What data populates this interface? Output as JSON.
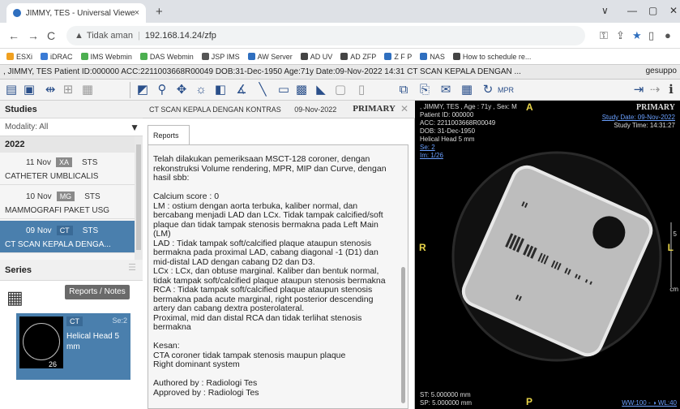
{
  "browser": {
    "tab_title": "JIMMY, TES - Universal Viewer :",
    "tab_close": "×",
    "new_tab": "+",
    "win_min": "∨",
    "win_dash": "—",
    "win_restore": "▢",
    "win_close": "✕",
    "back": "←",
    "forward": "→",
    "reload": "C",
    "security_warning": "▲",
    "security_label": "Tidak aman",
    "url": "192.168.14.24/zfp",
    "bookmarks": [
      {
        "label": "ESXi",
        "color": "#f0a020"
      },
      {
        "label": "iDRAC",
        "color": "#3a7bd5"
      },
      {
        "label": "IMS Webmin",
        "color": "#4caf50"
      },
      {
        "label": "DAS Webmin",
        "color": "#4caf50"
      },
      {
        "label": "JSP IMS",
        "color": "#555555"
      },
      {
        "label": "AW Server",
        "color": "#2f6fbf"
      },
      {
        "label": "AD UV",
        "color": "#444444"
      },
      {
        "label": "AD ZFP",
        "color": "#444444"
      },
      {
        "label": "Z F P",
        "color": "#2f6fbf"
      },
      {
        "label": "NAS",
        "color": "#2f6fbf"
      },
      {
        "label": "How to schedule re...",
        "color": "#444444"
      }
    ]
  },
  "patient_bar": {
    "text": ", JIMMY, TES  Patient ID:000000  ACC:2211003668R00049  DOB:31-Dec-1950  Age:71y  Date:09-Nov-2022  14:31  CT SCAN KEPALA DENGAN ...",
    "user": "gesuppo"
  },
  "studies": {
    "header": "Studies",
    "modality_label": "Modality: All",
    "year": "2022",
    "items": [
      {
        "date": "11 Nov",
        "modality": "XA",
        "status": "STS",
        "description": "CATHETER UMBLICALIS",
        "selected": false
      },
      {
        "date": "10 Nov",
        "modality": "MG",
        "status": "STS",
        "description": "MAMMOGRAFI PAKET USG",
        "selected": false
      },
      {
        "date": "09 Nov",
        "modality": "CT",
        "status": "STS",
        "description": "CT SCAN KEPALA DENGA...",
        "selected": true
      }
    ]
  },
  "series": {
    "header": "Series",
    "reports_button": "Reports / Notes",
    "card": {
      "modality": "CT",
      "series_no": "Se:2",
      "name": "Helical Head 5 mm",
      "thumb_count": "26"
    }
  },
  "report": {
    "header_title": "CT SCAN KEPALA DENGAN KONTRAS",
    "header_date": "09-Nov-2022",
    "header_badge": "PRIMARY",
    "tab_label": "Reports",
    "body": "Telah dilakukan pemeriksaan MSCT-128 coroner, dengan rekonstruksi Volume rendering, MPR, MIP dan Curve, dengan hasil sbb:\n\nCalcium score : 0\nLM : ostium dengan aorta terbuka, kaliber normal, dan bercabang menjadi LAD dan LCx. Tidak tampak calcified/soft plaque dan tidak tampak stenosis bermakna pada Left Main (LM)\nLAD : Tidak tampak soft/calcified plaque ataupun stenosis bermakna pada proximal LAD, cabang diagonal -1 (D1) dan mid-distal LAD dengan cabang D2 dan D3.\nLCx : LCx, dan obtuse marginal. Kaliber dan bentuk normal, tidak tampak soft/calcified plaque ataupun stenosis bermakna\nRCA : Tidak tampak soft/calcified plaque ataupun stenosis bermakna pada acute marginal, right posterior descending artery dan cabang dextra posterolateral.\nProximal, mid dan distal RCA dan tidak terlihat stenosis bermakna\n\nKesan:\nCTA coroner tidak tampak stenosis maupun plaque\nRight dominant system\n\nAuthored by : Radiologi Tes\nApproved by : Radiologi Tes"
  },
  "viewer": {
    "patient": ", JIMMY, TES ,  Age : 71y ,  Sex: M",
    "patient_id": "Patient ID: 000000",
    "acc": "ACC: 2211003668R00049",
    "dob": "DOB: 31-Dec-1950",
    "series_desc": "Helical Head 5 mm",
    "se": "Se: 2",
    "im": "Im: 1/26",
    "primary": "PRIMARY",
    "study_date": "Study Date: 09-Nov-2022",
    "study_time": "Study Time: 14:31:27",
    "orient_top": "A",
    "orient_left": "R",
    "orient_right": "L",
    "orient_bottom": "P",
    "st": "ST: 5.000000 mm",
    "sp": "SP: 5.000000 mm",
    "ww": "WW:100 - ◑ WL:40",
    "scale_mark": "5",
    "scale_unit": "cm"
  }
}
